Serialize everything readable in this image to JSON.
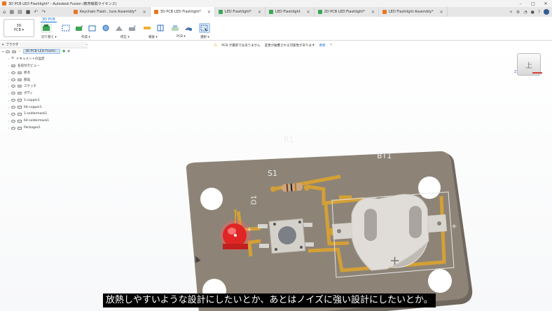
{
  "window": {
    "title": "3D PCB LED Flashlight* - Autodesk Fusion (教育機関ライセンス)",
    "controls": [
      "–",
      "□",
      "✕"
    ]
  },
  "tabs": [
    {
      "label": "Keychain Flash…ture Assembly*",
      "icon_color": "#e87722",
      "active": false
    },
    {
      "label": "3D PCB LED Flashlight*",
      "icon_color": "#e87722",
      "active": true
    },
    {
      "label": "LED Flashlight*",
      "icon_color": "#3aa655",
      "active": false
    },
    {
      "label": "LED Flashlight",
      "icon_color": "#3aa655",
      "active": false
    },
    {
      "label": "2D PCB LED Flashlight*",
      "icon_color": "#3aa655",
      "active": false
    },
    {
      "label": "LED Flashlight Assembly*",
      "icon_color": "#e87722",
      "active": false
    }
  ],
  "user": {
    "initials": "TK"
  },
  "ribbon": {
    "active_tab": "3D PCB",
    "workspace": {
      "line1": "3D",
      "line2": "PCB ▾"
    },
    "groups": [
      {
        "label": "切り替え ▾"
      },
      {
        "label": "作成 ▾"
      },
      {
        "label": "修正 ▾"
      },
      {
        "label": "検査 ▾"
      },
      {
        "label": "PCB ▾"
      },
      {
        "label": "選択 ▾"
      }
    ]
  },
  "notification": {
    "message": "PCB が最新ではありません",
    "detail": "変更が破棄される可能性があります",
    "action": "更新"
  },
  "browser": {
    "title": "ブラウザ",
    "root": "3D PCB LED Flashli…",
    "items": [
      {
        "label": "ドキュメントの設定",
        "icon": "gear"
      },
      {
        "label": "名前付きビュー",
        "icon": "folder"
      },
      {
        "label": "原点",
        "icon": "folder"
      },
      {
        "label": "部品",
        "icon": "folder"
      },
      {
        "label": "スケッチ",
        "icon": "folder"
      },
      {
        "label": "ボディ",
        "icon": "folder"
      },
      {
        "label": "1-copper1",
        "icon": "layer"
      },
      {
        "label": "64-copper1",
        "icon": "layer"
      },
      {
        "label": "1-soldermask1",
        "icon": "layer"
      },
      {
        "label": "64-soldermask1",
        "icon": "layer"
      },
      {
        "label": "Packages1",
        "icon": "layer"
      }
    ]
  },
  "viewcube": {
    "face": "上",
    "axis_z": "Z",
    "axis_x": "X"
  },
  "board": {
    "labels": {
      "resistor": "R1",
      "switch": "S1",
      "battery": "BT1",
      "led": "D1"
    },
    "colors": {
      "board": "#8d8477",
      "copper": "#d4a035",
      "led": "#e02525",
      "silkscreen": "#eeeeee"
    }
  },
  "subtitle": "放熱しやすいような設計にしたいとか、あとはノイズに強い設計にしたいとか。"
}
